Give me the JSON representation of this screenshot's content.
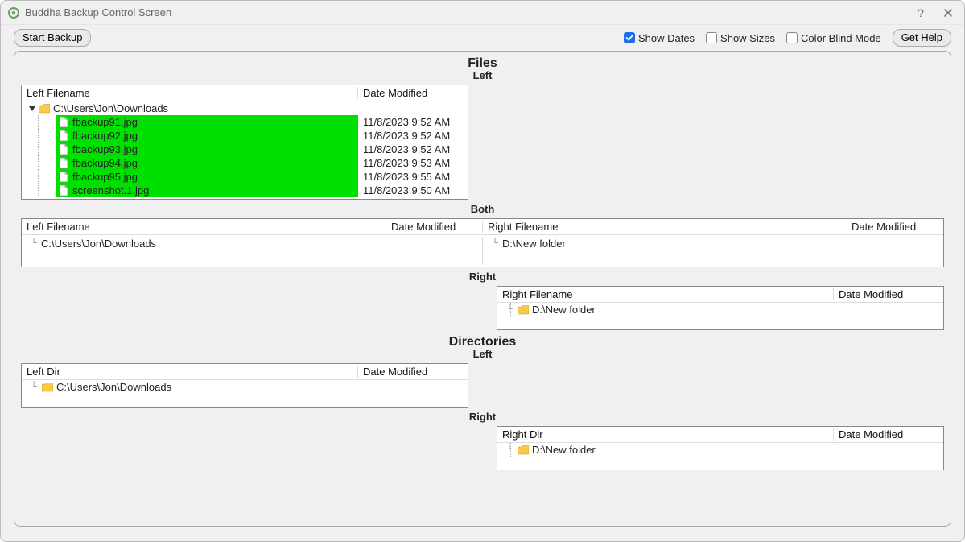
{
  "window": {
    "title": "Buddha Backup Control Screen"
  },
  "toolbar": {
    "start_backup": "Start Backup",
    "show_dates": "Show Dates",
    "show_sizes": "Show Sizes",
    "color_blind_mode": "Color Blind Mode",
    "get_help": "Get Help",
    "show_dates_checked": true,
    "show_sizes_checked": false,
    "color_blind_checked": false
  },
  "sections": {
    "files": "Files",
    "directories": "Directories",
    "left": "Left",
    "right": "Right",
    "both": "Both"
  },
  "headers": {
    "left_filename": "Left Filename",
    "right_filename": "Right Filename",
    "date_modified": "Date Modified",
    "left_dir": "Left Dir",
    "right_dir": "Right Dir"
  },
  "files_left": {
    "root": "C:\\Users\\Jon\\Downloads",
    "items": [
      {
        "name": "fbackup91.jpg",
        "date": "11/8/2023 9:52 AM"
      },
      {
        "name": "fbackup92.jpg",
        "date": "11/8/2023 9:52 AM"
      },
      {
        "name": "fbackup93.jpg",
        "date": "11/8/2023 9:52 AM"
      },
      {
        "name": "fbackup94.jpg",
        "date": "11/8/2023 9:53 AM"
      },
      {
        "name": "fbackup95.jpg",
        "date": "11/8/2023 9:55 AM"
      },
      {
        "name": "screenshot.1.jpg",
        "date": "11/8/2023 9:50 AM"
      }
    ]
  },
  "files_both": {
    "left_root": "C:\\Users\\Jon\\Downloads",
    "right_root": "D:\\New folder"
  },
  "files_right": {
    "root": "D:\\New folder"
  },
  "dirs_left": {
    "root": "C:\\Users\\Jon\\Downloads"
  },
  "dirs_right": {
    "root": "D:\\New folder"
  }
}
